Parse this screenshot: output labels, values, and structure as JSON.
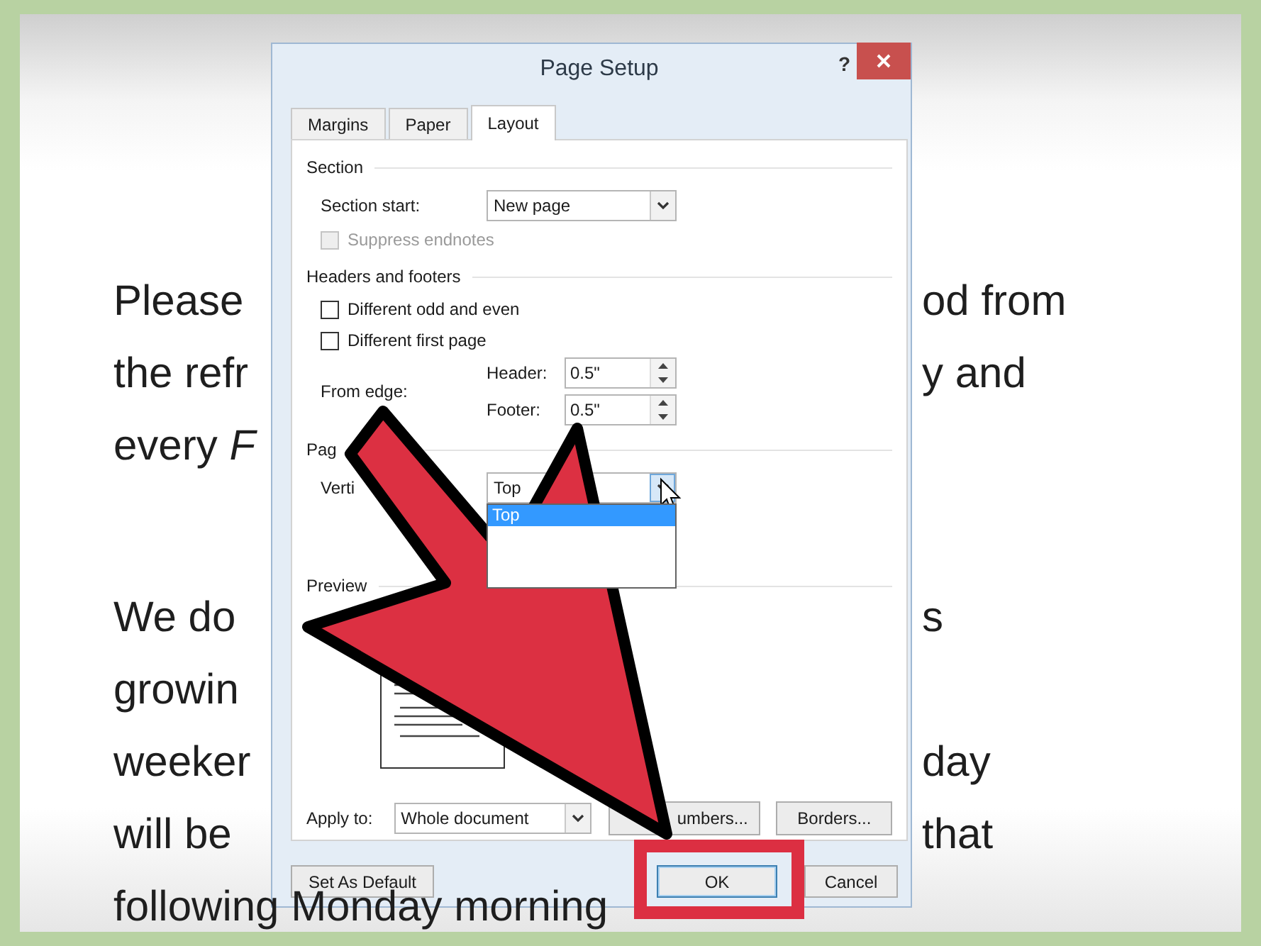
{
  "document": {
    "paragraphs": [
      {
        "lines": [
          {
            "left": "Please",
            "right": "od from"
          },
          {
            "left": "the refr",
            "right": "y and"
          },
          {
            "left": "every *F*"
          }
        ]
      },
      {
        "lines": [
          {
            "left": "We do",
            "right": "s"
          },
          {
            "left": "growin"
          },
          {
            "left": "weeker",
            "right": "day"
          },
          {
            "left": "will be",
            "right": "that"
          },
          {
            "left": "following Monday morning"
          }
        ]
      }
    ]
  },
  "dialog": {
    "title": "Page Setup",
    "help": "?",
    "tabs": [
      {
        "label": "Margins",
        "selected": false
      },
      {
        "label": "Paper",
        "selected": false
      },
      {
        "label": "Layout",
        "selected": true
      }
    ],
    "panel": [
      {
        "kind": "heading",
        "label": "Section"
      },
      {
        "kind": "select",
        "label": "Section start:",
        "value": "New page",
        "expanded": false
      },
      {
        "kind": "checkbox",
        "label": "Suppress endnotes",
        "checked": false,
        "disabled": true
      },
      {
        "kind": "heading",
        "label": "Headers and footers"
      },
      {
        "kind": "checkbox",
        "label": "Different odd and even",
        "checked": false,
        "disabled": false
      },
      {
        "kind": "checkbox",
        "label": "Different first page",
        "checked": false,
        "disabled": false
      },
      {
        "kind": "spinners",
        "label": "From edge:",
        "fields": [
          {
            "label": "Header:",
            "value": "0.5\""
          },
          {
            "label": "Footer:",
            "value": "0.5\""
          }
        ]
      },
      {
        "kind": "heading",
        "label": "Pag"
      },
      {
        "kind": "select",
        "label": "Verti",
        "value": "Top",
        "expanded": true,
        "options": [
          {
            "label": "Top",
            "selected": true
          }
        ]
      },
      {
        "kind": "heading",
        "label": "Preview"
      },
      {
        "kind": "preview"
      },
      {
        "kind": "apply",
        "label": "Apply to:",
        "value": "Whole document",
        "buttons": [
          "umbers...",
          "Borders..."
        ]
      }
    ],
    "buttons": [
      {
        "label": "Set As Default",
        "highlighted": false
      },
      {
        "label": "OK",
        "highlighted": true
      },
      {
        "label": "Cancel",
        "highlighted": false
      }
    ]
  }
}
